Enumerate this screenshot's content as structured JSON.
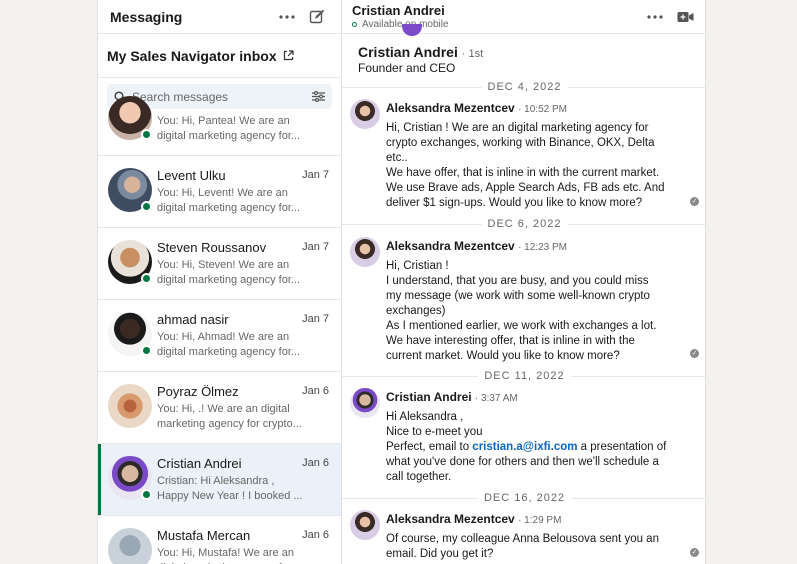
{
  "left": {
    "title": "Messaging",
    "inbox_label": "My Sales Navigator inbox",
    "search_placeholder": "Search messages",
    "conversations": [
      {
        "name": "",
        "date": "",
        "snippet": "You: Hi, Pantea! We are an digital marketing agency for...",
        "online": true
      },
      {
        "name": "Levent Ulku",
        "date": "Jan 7",
        "snippet": "You: Hi, Levent! We are an digital marketing agency for...",
        "online": true
      },
      {
        "name": "Steven Roussanov",
        "date": "Jan 7",
        "snippet": "You: Hi, Steven! We are an digital marketing agency for...",
        "online": true
      },
      {
        "name": "ahmad nasir",
        "date": "Jan 7",
        "snippet": "You: Hi, Ahmad! We are an digital marketing agency for...",
        "online": true
      },
      {
        "name": "Poyraz Ölmez",
        "date": "Jan 6",
        "snippet": "You: Hi, .! We are an digital marketing agency for crypto...",
        "online": false
      },
      {
        "name": "Cristian Andrei",
        "date": "Jan 6",
        "snippet": "Cristian: Hi Aleksandra , Happy New Year ! I booked ...",
        "online": true,
        "active": true
      },
      {
        "name": "Mustafa Mercan",
        "date": "Jan 6",
        "snippet": "You: Hi, Mustafa! We are an digital marketing agency for...",
        "online": false
      }
    ]
  },
  "right": {
    "header_name": "Cristian Andrei",
    "header_status": "Available on mobile",
    "profile_name": "Cristian Andrei",
    "profile_degree": "· 1st",
    "profile_title": "Founder and CEO",
    "dates": [
      "DEC 4, 2022",
      "DEC 6, 2022",
      "DEC 11, 2022",
      "DEC 16, 2022"
    ],
    "messages": [
      {
        "sender": "Aleksandra Mezentcev",
        "time": "· 10:52 PM",
        "lines": [
          "Hi, Cristian ! We are an digital marketing agency for",
          "crypto exchanges, working with Binance, OKX, Delta",
          "etc..",
          "We have offer, that is inline in with the current market.",
          "We use Brave ads, Apple Search Ads, FB ads etc. And",
          "deliver $1 sign-ups. Would you like to know more?"
        ]
      },
      {
        "sender": "Aleksandra Mezentcev",
        "time": "· 12:23 PM",
        "lines": [
          "Hi, Cristian !",
          "I understand, that you are busy, and you could miss",
          "my message (we work with some well-known crypto",
          "exchanges)",
          "As I mentioned earlier, we work with exchanges a lot.",
          "We have interesting offer, that is inline in with the",
          "current market.  Would you like to know more?"
        ]
      },
      {
        "sender": "Cristian Andrei",
        "time": "· 3:37 AM",
        "lines": [
          "Hi Aleksandra ,",
          "Nice to e-meet you"
        ],
        "link_prefix": "Perfect, email to ",
        "link": "cristian.a@ixfi.com",
        "link_suffix": " a presentation of",
        "lines_after": [
          "what you've done for others and then we'll schedule a",
          "call together."
        ]
      },
      {
        "sender": "Aleksandra Mezentcev",
        "time": "· 1:29 PM",
        "lines": [
          "Of course, my colleague Anna Belousova sent you an",
          "email. Did you get it?"
        ]
      }
    ]
  },
  "colors": {
    "online": "#057642",
    "link": "#0a66c2",
    "active_bg": "#eaf1f8",
    "search_bg": "#eef3f8"
  }
}
